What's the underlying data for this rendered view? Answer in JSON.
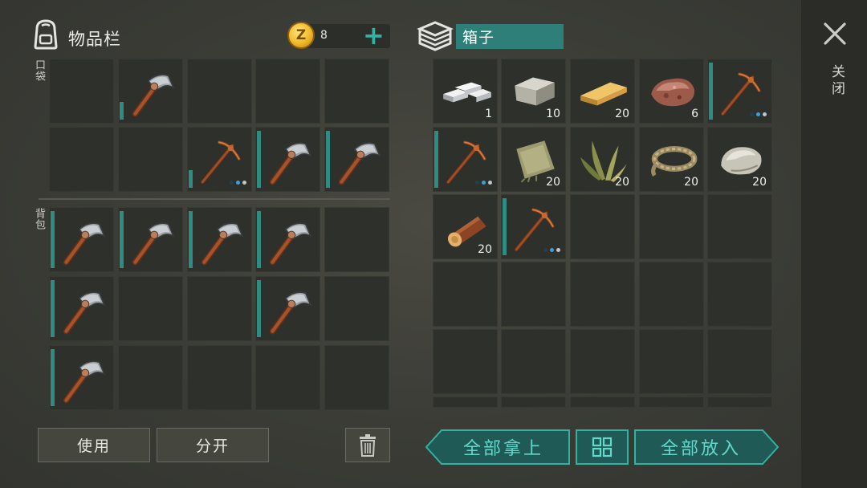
{
  "inventory": {
    "title": "物品栏",
    "coin_symbol": "Z",
    "coin_count": "8",
    "add_coin_label": "+",
    "pocket_label": "口袋",
    "backpack_label": "背包"
  },
  "chest": {
    "title": "箱子"
  },
  "chest_slots": [
    {
      "item": "iron-bars",
      "qty": "1"
    },
    {
      "item": "stone-block",
      "qty": "10"
    },
    {
      "item": "plank",
      "qty": "20"
    },
    {
      "item": "iron-ore",
      "qty": "6"
    },
    {
      "item": "pickaxe",
      "qty": ""
    },
    {
      "item": "pickaxe",
      "qty": ""
    },
    {
      "item": "cloth",
      "qty": "20"
    },
    {
      "item": "grass",
      "qty": "20"
    },
    {
      "item": "rope",
      "qty": "20"
    },
    {
      "item": "stone",
      "qty": "20"
    },
    {
      "item": "log",
      "qty": "20"
    },
    {
      "item": "pickaxe",
      "qty": ""
    }
  ],
  "buttons": {
    "use": "使用",
    "split": "分开",
    "take_all": "全部拿上",
    "put_all": "全部放入",
    "close": "关闭"
  },
  "colors": {
    "accent": "#2fb3a3",
    "slot_bg": "#2e302b",
    "durability": "#2f8c83"
  }
}
